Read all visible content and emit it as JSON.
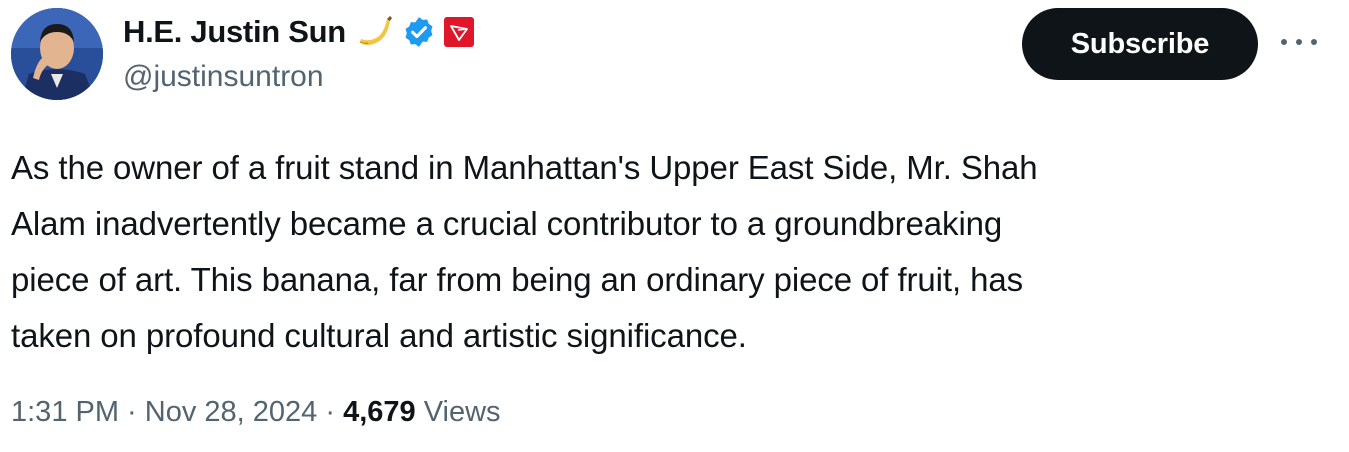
{
  "author": {
    "display_name": "H.E. Justin Sun",
    "handle": "@justinsuntron",
    "badges": [
      "banana-emoji-icon",
      "verified-badge-icon",
      "tron-logo-icon"
    ]
  },
  "actions": {
    "subscribe_label": "Subscribe",
    "more_icon": "more-options-icon"
  },
  "tweet": {
    "text": "As the owner of a fruit stand in Manhattan's Upper East Side, Mr. Shah\nAlam inadvertently became a crucial contributor to a groundbreaking\npiece of art. This banana, far from being an ordinary piece of fruit, has\ntaken on profound cultural and artistic significance.",
    "time": "1:31 PM",
    "separator": " · ",
    "date": "Nov 28, 2024",
    "views_count": "4,679",
    "views_label": " Views"
  },
  "colors": {
    "text": "#0f1419",
    "secondary": "#536471",
    "verified": "#1d9bf0",
    "tron_red": "#e0162b",
    "button_bg": "#0f1419"
  }
}
